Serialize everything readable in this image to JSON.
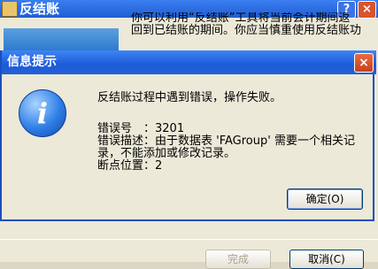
{
  "background_window": {
    "title": "反结账",
    "help_glyph": "?",
    "close_glyph": "×",
    "description": [
      "你可以利用“反结账”工具将当前会计期间返",
      "回到已结账的期间。你应当慎重使用反结账功"
    ],
    "buttons": {
      "finish": "完成",
      "cancel": "取消(C)"
    }
  },
  "dialog": {
    "title": "信息提示",
    "close_glyph": "×",
    "icon": "info-icon",
    "icon_glyph": "i",
    "message": "反结账过程中遇到错误，操作失败。",
    "details": [
      "错误号　：3201",
      "错误描述：由于数据表 'FAGroup' 需要一个相关记",
      "录，不能添加或修改记录。",
      "断点位置：2"
    ],
    "ok_label": "确定(O)"
  },
  "colors": {
    "titlebar": "#2a66dc",
    "close_button": "#d9542e",
    "window_bg": "#ece9d8"
  }
}
